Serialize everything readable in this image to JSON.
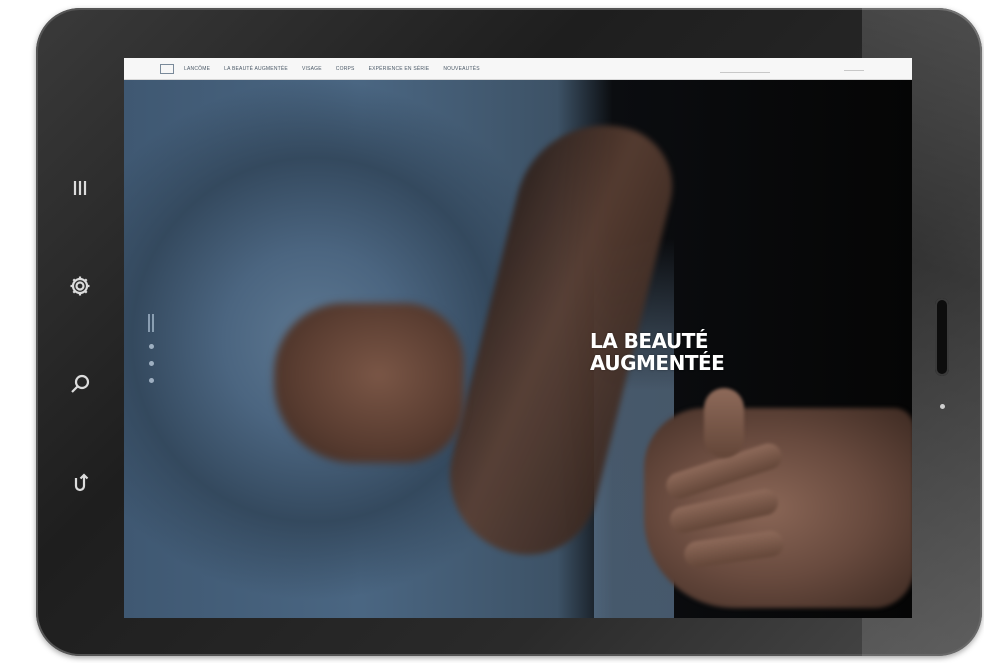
{
  "topbar": {
    "menu": [
      "LANCÔME",
      "LA BEAUTÉ AUGMENTÉE",
      "VISAGE",
      "CORPS",
      "EXPÉRIENCE EN SÉRIE",
      "NOUVEAUTÉS"
    ]
  },
  "hero": {
    "title_line1": "LA BEAUTÉ",
    "title_line2": "AUGMENTÉE"
  },
  "side_nav": [
    {
      "icon": "menu-icon"
    },
    {
      "icon": "gear-icon"
    },
    {
      "icon": "search-icon"
    },
    {
      "icon": "share-icon"
    }
  ],
  "colors": {
    "bezel": "#1e1e1e",
    "hero_blue": "#4a6682",
    "title_text": "#ffffff"
  }
}
